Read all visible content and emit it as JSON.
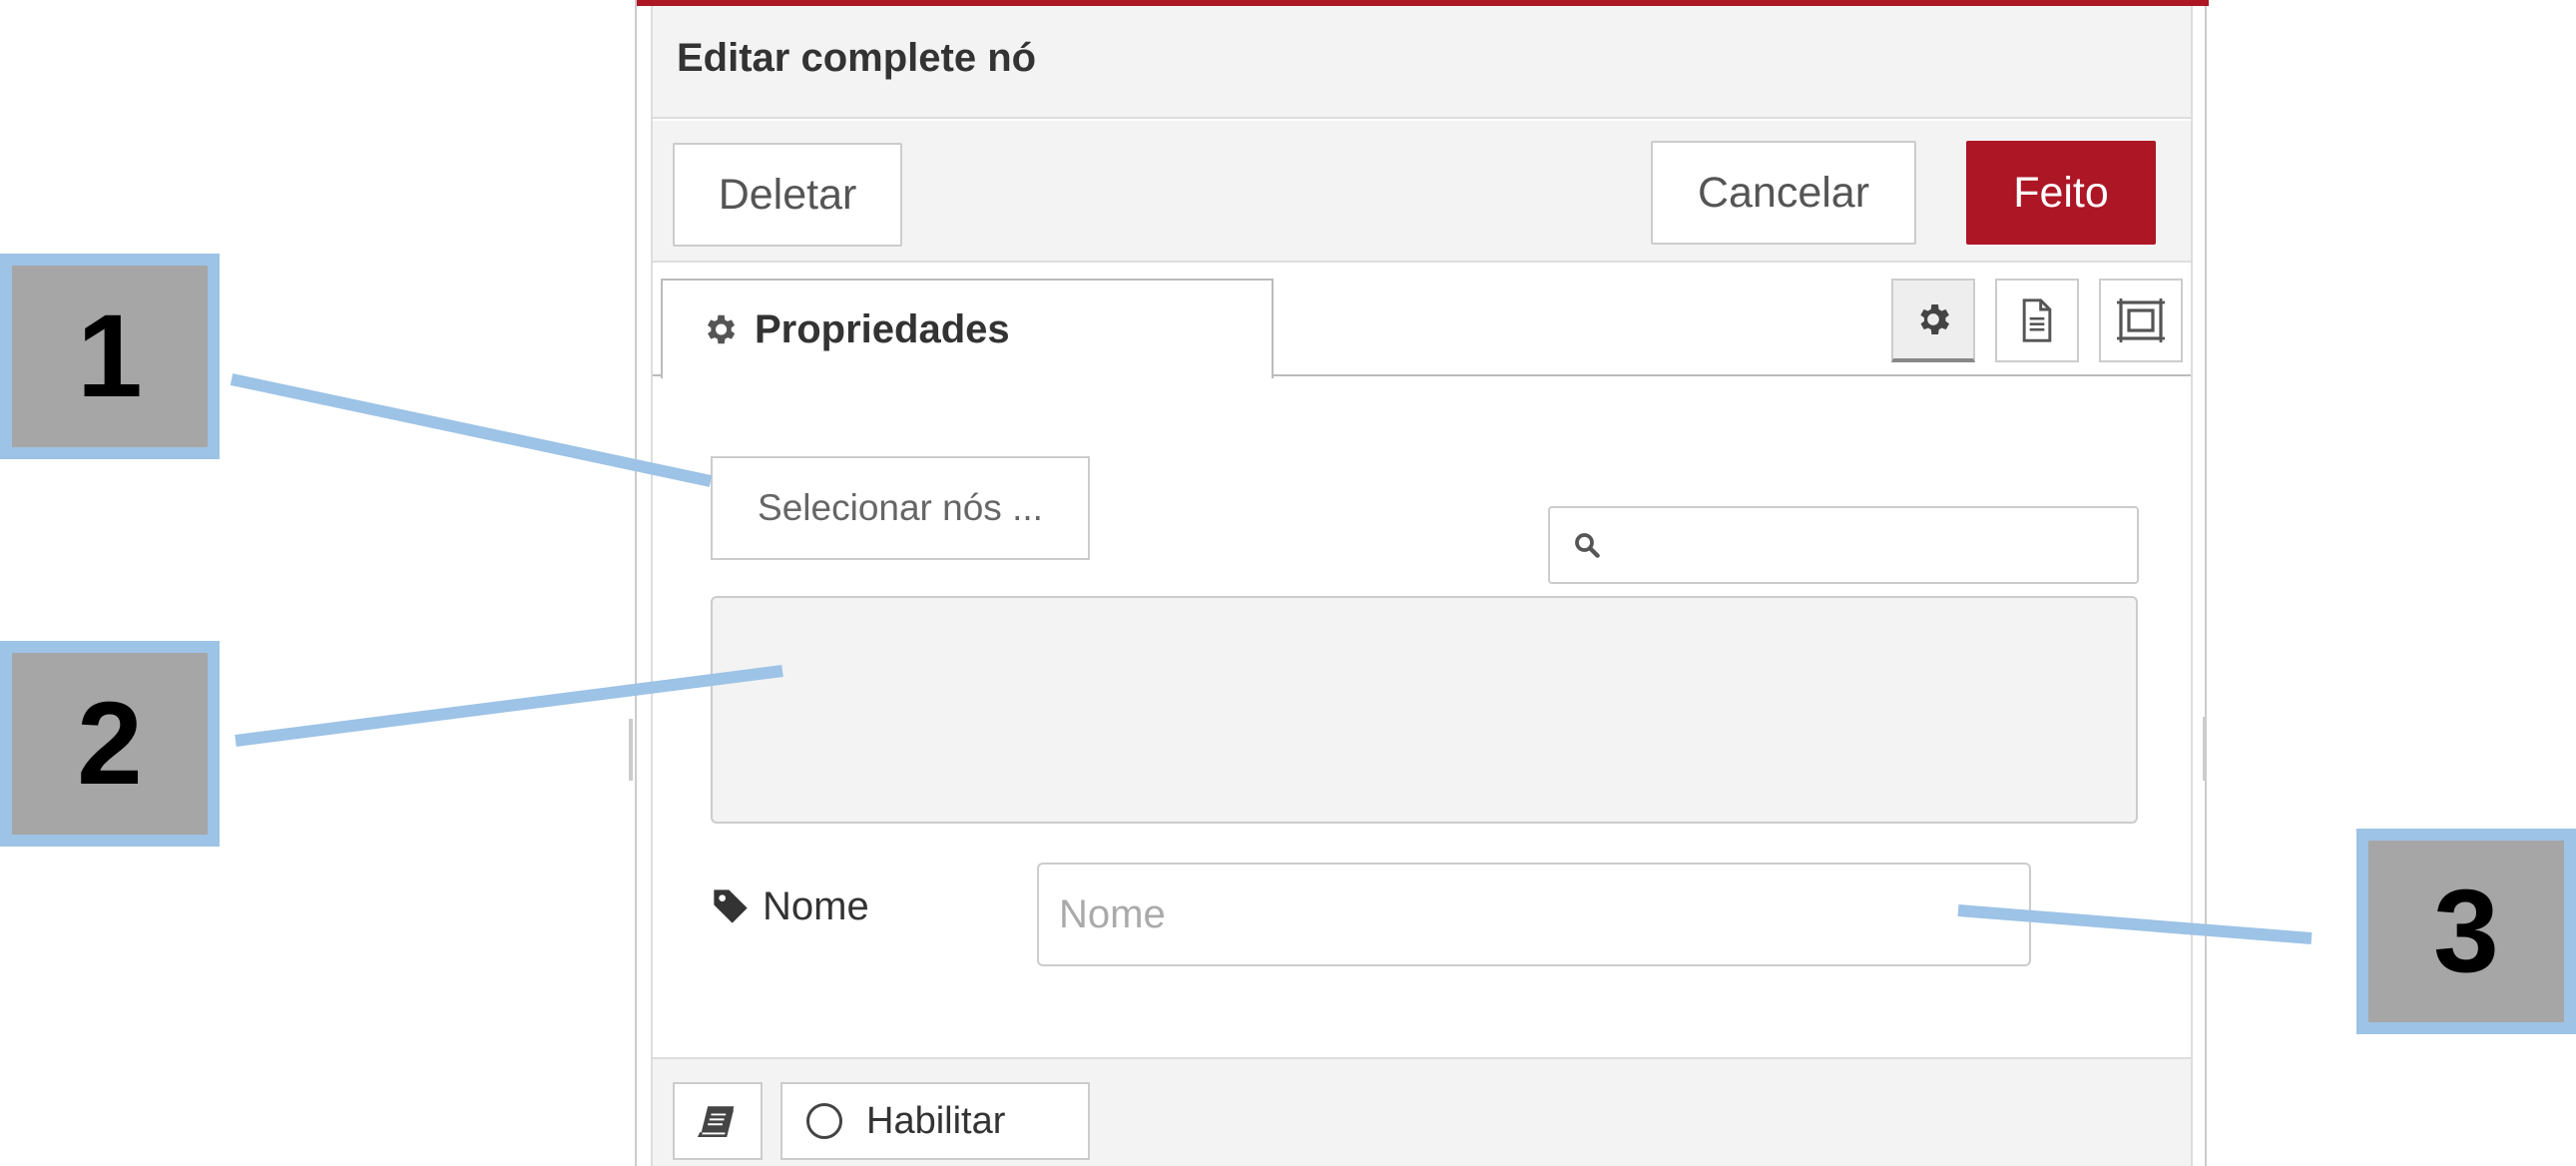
{
  "dialog": {
    "title": "Editar complete nó",
    "buttons": {
      "delete_label": "Deletar",
      "cancel_label": "Cancelar",
      "done_label": "Feito"
    },
    "tabs": {
      "properties_label": "Propriedades",
      "icons": [
        "gear-icon",
        "document-icon",
        "frame-icon"
      ]
    },
    "content": {
      "select_nodes_label": "Selecionar nós ...",
      "search_placeholder": "",
      "name_label": "Nome",
      "name_placeholder": "Nome",
      "name_value": ""
    },
    "footer": {
      "enable_label": "Habilitar"
    }
  },
  "callouts": [
    "1",
    "2",
    "3"
  ],
  "colors": {
    "accent": "#ad1625",
    "callout_border": "#9dc3e6",
    "callout_fill": "#a6a6a6",
    "panel_bg": "#f3f3f3"
  }
}
